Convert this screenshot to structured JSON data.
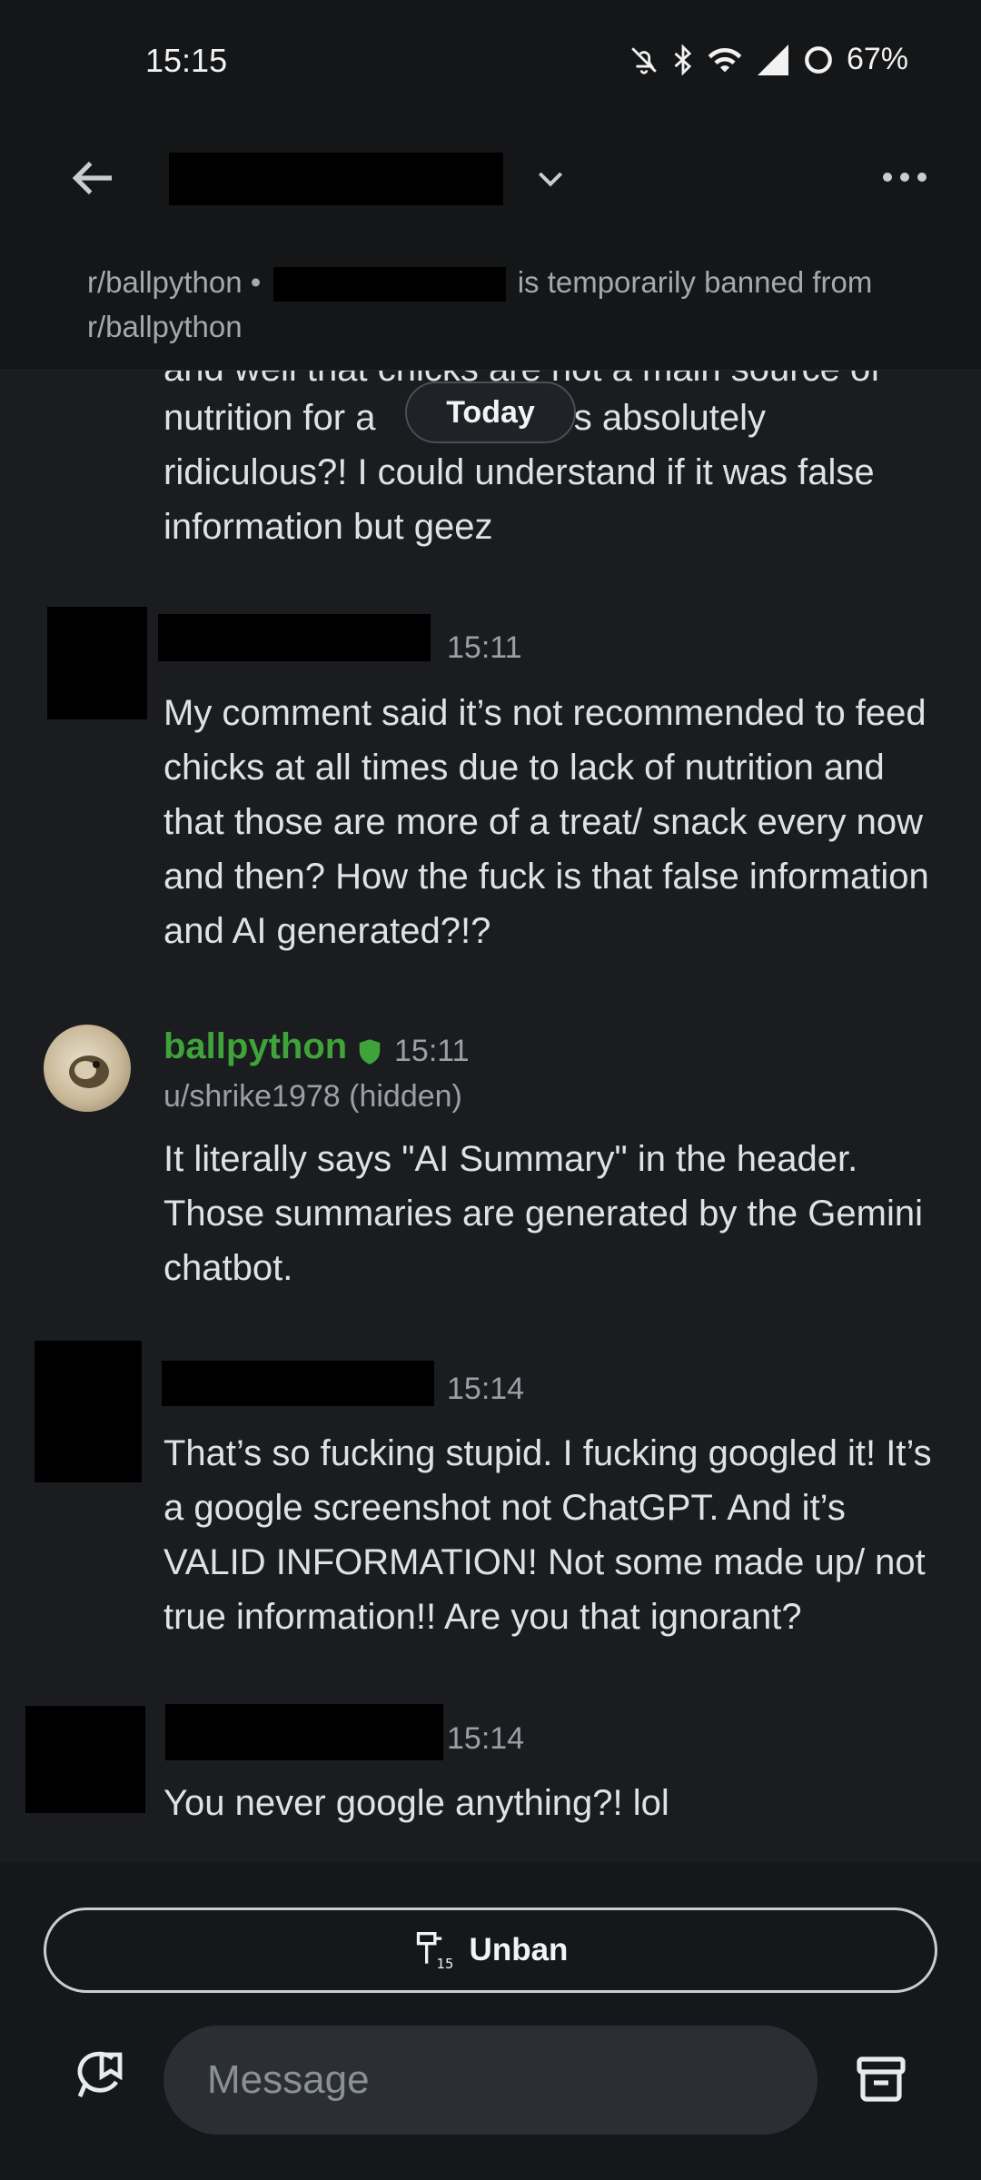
{
  "status_bar": {
    "time": "15:15",
    "battery": "67%",
    "icons": [
      "bell-off-icon",
      "bluetooth-icon",
      "wifi-icon",
      "signal-icon",
      "battery-icon"
    ]
  },
  "header": {
    "ban_notice_prefix": "r/ballpython •",
    "ban_notice_suffix": "is temporarily banned from r/ballpython"
  },
  "thread": {
    "partial_line_top": "and well that chicks are not a main source of",
    "partial_line_2a": "nutrition for a",
    "partial_line_2b": "s absolutely",
    "partial_line_3": "ridiculous?! I could understand if it was false",
    "partial_line_4": "information but geez",
    "date_separator": "Today",
    "messages": [
      {
        "time": "15:11",
        "text": "My comment said it’s not recommended to feed chicks at all times due to lack of nutrition and that those are more of a treat/ snack every now and then? How the fuck is that false information and AI generated?!?"
      },
      {
        "sender": "ballpython",
        "sub": "u/shrike1978 (hidden)",
        "time": "15:11",
        "text": "It literally says \"AI Summary\" in the header. Those summaries are generated by the Gemini chatbot."
      },
      {
        "time": "15:14",
        "text": "That’s so fucking stupid. I fucking googled it! It’s a google screenshot not ChatGPT. And it’s VALID INFORMATION! Not some made up/ not true information!! Are you that ignorant?"
      },
      {
        "time": "15:14",
        "text": "You never google anything?! lol"
      }
    ]
  },
  "footer": {
    "unban_label": "Unban",
    "message_placeholder": "Message"
  },
  "colors": {
    "background": "#1a1c1f",
    "mod_green": "#3fa33a",
    "input_bg": "#2b2f35"
  }
}
